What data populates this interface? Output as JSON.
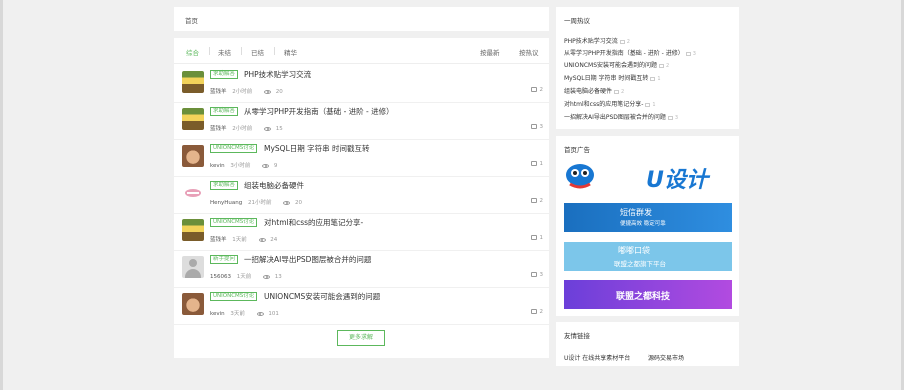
{
  "breadcrumb": {
    "label": "首页"
  },
  "tabs": [
    "综合",
    "未结",
    "已结",
    "精华"
  ],
  "sort": [
    "按最新",
    "按热议"
  ],
  "threads": [
    {
      "tag": "求助解答",
      "title": "PHP技术贴学习交流",
      "author": "蓝钱羊",
      "time": "2小时前",
      "views": "20",
      "comments": "2",
      "avatar": "bart"
    },
    {
      "tag": "求助解答",
      "title": "从零学习PHP开发指南（基础 - 进阶 - 进修）",
      "author": "蓝钱羊",
      "time": "2小时前",
      "views": "15",
      "comments": "3",
      "avatar": "bart"
    },
    {
      "tag": "UNIONCMS讨论",
      "title": "MySQL日期 字符串 时间戳互转",
      "author": "kevin",
      "time": "3小时前",
      "views": "9",
      "comments": "1",
      "avatar": "monkey"
    },
    {
      "tag": "求助解答",
      "title": "组装电脑必备硬件",
      "author": "HenyHuang",
      "time": "21小时前",
      "views": "20",
      "comments": "2",
      "avatar": "lips"
    },
    {
      "tag": "UNIONCMS讨论",
      "title": "对html和css的应用笔记分享-",
      "author": "蓝钱羊",
      "time": "1天前",
      "views": "24",
      "comments": "1",
      "avatar": "bart"
    },
    {
      "tag": "新手提问",
      "title": "一招解决AI导出PSD图层被合并的问题",
      "author": "156063",
      "time": "1天前",
      "views": "13",
      "comments": "3",
      "avatar": "default"
    },
    {
      "tag": "UNIONCMS讨论",
      "title": "UNIONCMS安装可能会遇到的问题",
      "author": "kevin",
      "time": "3天前",
      "views": "101",
      "comments": "2",
      "avatar": "monkey"
    }
  ],
  "more_button": "更多求解",
  "hot": {
    "title": "一周热议",
    "items": [
      {
        "title": "PHP技术贴学习交流",
        "count": "2"
      },
      {
        "title": "从零学习PHP开发指南（基础 - 进阶 - 进修）",
        "count": "3"
      },
      {
        "title": "UNIONCMS安装可能会遇到的问题",
        "count": "2"
      },
      {
        "title": "MySQL日期 字符串 时间戳互转",
        "count": "1"
      },
      {
        "title": "组装电脑必备硬件",
        "count": "2"
      },
      {
        "title": "对html和css的应用笔记分享-",
        "count": "1"
      },
      {
        "title": "一招解决AI导出PSD图层被合并的问题",
        "count": "3"
      }
    ]
  },
  "ads": {
    "title": "首页广告",
    "logo_text": "U设计",
    "ad1": {
      "line1": "短信群发",
      "line2": "便捷高效 稳定可靠"
    },
    "ad2": {
      "line1": "嘟嘟口袋",
      "line2": "联盟之都旗下平台"
    },
    "ad3": {
      "line1": "联盟之都科技"
    }
  },
  "links": {
    "title": "友情链接",
    "items": [
      "U设计 在线共享素材平台",
      "源码交易市场"
    ]
  },
  "colors": {
    "accent": "#5cb85c",
    "logo_blue": "#1877d2",
    "logo_red": "#e53935"
  }
}
